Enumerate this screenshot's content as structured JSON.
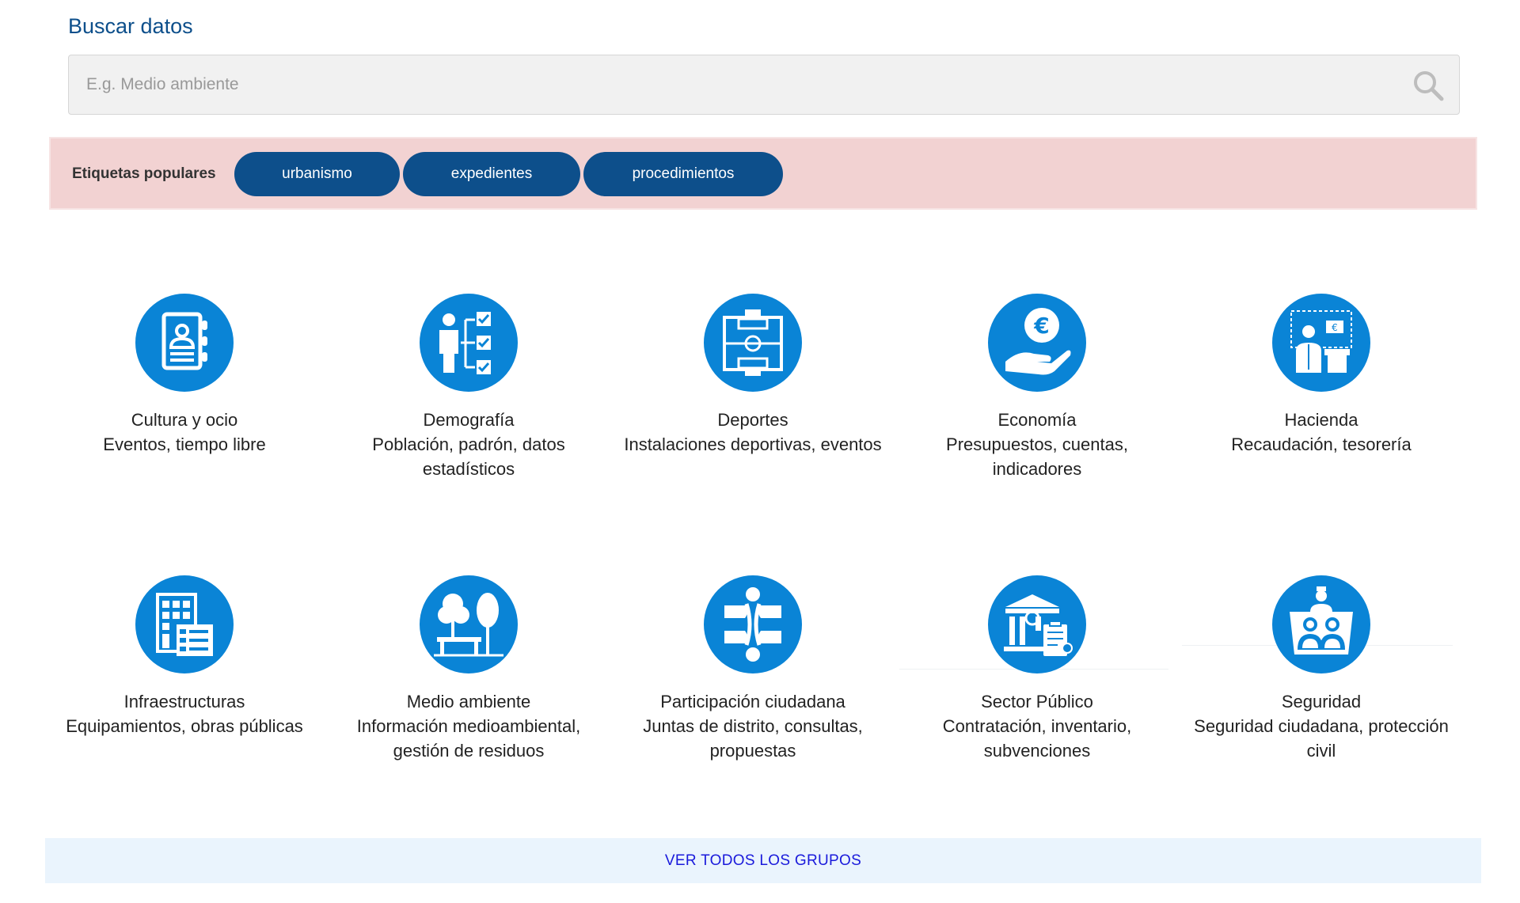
{
  "search": {
    "title": "Buscar datos",
    "placeholder": "E.g. Medio ambiente",
    "value": ""
  },
  "tags": {
    "label": "Etiquetas populares",
    "items": [
      "urbanismo",
      "expedientes",
      "procedimientos"
    ]
  },
  "categories": [
    {
      "title": "Cultura y ocio",
      "desc": "Eventos, tiempo libre",
      "icon": "address-book-icon"
    },
    {
      "title": "Demografía",
      "desc": "Población, padrón, datos estadísticos",
      "icon": "person-checklist-icon"
    },
    {
      "title": "Deportes",
      "desc": "Instalaciones deportivas, eventos",
      "icon": "football-field-icon"
    },
    {
      "title": "Economía",
      "desc": "Presupuestos, cuentas, indicadores",
      "icon": "euro-hand-icon"
    },
    {
      "title": "Hacienda",
      "desc": "Recaudación, tesorería",
      "icon": "presenter-euro-icon"
    },
    {
      "title": "Infraestructuras",
      "desc": "Equipamientos, obras públicas",
      "icon": "buildings-icon"
    },
    {
      "title": "Medio ambiente",
      "desc": "Información medioambiental, gestión de residuos",
      "icon": "trees-bench-icon"
    },
    {
      "title": "Participación ciudadana",
      "desc": "Juntas de distrito, consultas, propuestas",
      "icon": "people-puzzle-icon"
    },
    {
      "title": "Sector Público",
      "desc": "Contratación, inventario, subvenciones",
      "icon": "government-building-icon"
    },
    {
      "title": "Seguridad",
      "desc": "Seguridad ciudadana, protección civil",
      "icon": "security-guard-icon"
    }
  ],
  "footer": {
    "link_label": "VER TODOS LOS GRUPOS"
  },
  "colors": {
    "icon_blue": "#0a84d6",
    "dark_blue": "#0d4f8b",
    "tag_bar_bg": "#f2d2d2",
    "footer_bg": "#eaf4fd",
    "link": "#1a1adb"
  }
}
